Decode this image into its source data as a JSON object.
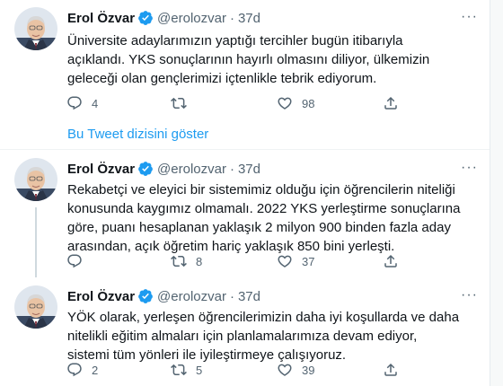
{
  "colors": {
    "accent": "#1d9bf0",
    "text": "#0f1419",
    "muted": "#536471",
    "divider": "#eff3f4"
  },
  "author": {
    "name": "Erol Özvar",
    "handle": "@erolozvar",
    "verified": true,
    "avatar_icon": "profile-photo"
  },
  "show_thread": "Bu Tweet dizisini göster",
  "tweets": [
    {
      "time": "37d",
      "text": "Üniversite adaylarımızın yaptığı tercihler bugün itibarıyla açıklandı. YKS sonuçlarının hayırlı olmasını diliyor, ülkemizin geleceği olan gençlerimizi içtenlikle tebrik ediyorum.",
      "replies": "4",
      "retweets": "",
      "likes": "98"
    },
    {
      "time": "37d",
      "text": "Rekabetçi ve eleyici bir sistemimiz olduğu için öğrencilerin niteliği konusunda kaygımız olmamalı. 2022 YKS yerleştirme sonuçlarına göre, puanı hesaplanan yaklaşık 2 milyon 900 binden fazla aday arasından, açık öğretim hariç yaklaşık 850 bini yerleşti.",
      "replies": "",
      "retweets": "8",
      "likes": "37"
    },
    {
      "time": "37d",
      "text": "YÖK olarak, yerleşen öğrencilerimizin daha iyi koşullarda ve daha nitelikli eğitim almaları için planlamalarımıza devam ediyor, sistemi tüm yönleri ile iyileştirmeye çalışıyoruz.",
      "replies": "2",
      "retweets": "5",
      "likes": "39"
    }
  ]
}
